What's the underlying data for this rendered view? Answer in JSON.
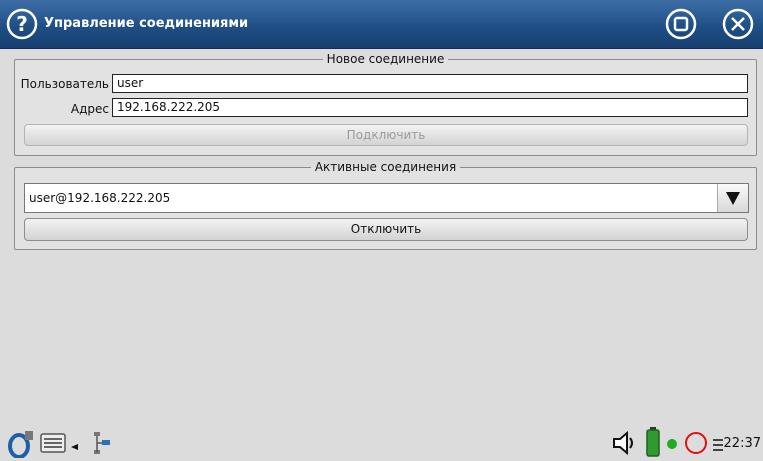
{
  "window": {
    "title": "Управление соединениями"
  },
  "new_connection": {
    "legend": "Новое соединение",
    "user_label": "Пользователь",
    "user_value": "user",
    "address_label": "Адрес",
    "address_value": "192.168.222.205",
    "connect_button": "Подключить",
    "connect_enabled": false
  },
  "active_connections": {
    "legend": "Активные соединения",
    "selected": "user@192.168.222.205",
    "disconnect_button": "Отключить"
  },
  "taskbar": {
    "icons": [
      "app-logo-icon",
      "keyboard-icon",
      "network-icon",
      "speaker-icon",
      "battery-icon",
      "status-dot-icon",
      "record-icon",
      "menu-icon"
    ],
    "status_dot_color": "#22aa22",
    "record_color": "#dd1111",
    "clock": "22:37"
  },
  "colors": {
    "titlebar": "#1f4f86",
    "background": "#dcdcdc"
  }
}
